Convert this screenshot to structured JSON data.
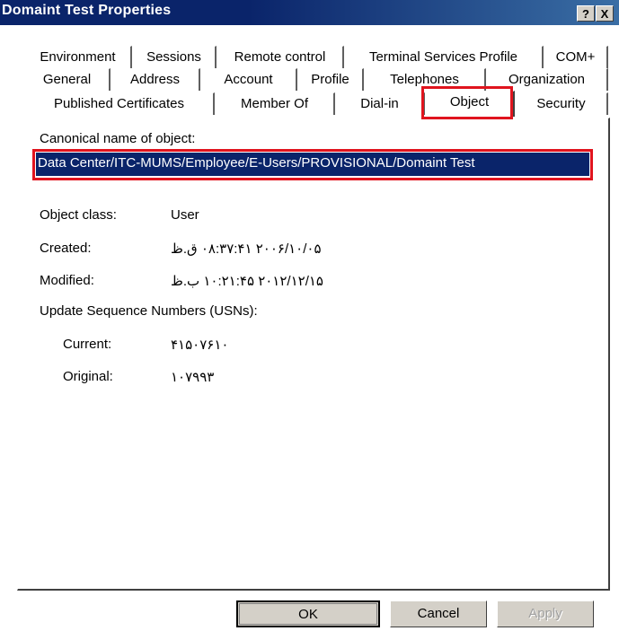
{
  "window": {
    "title": "Domaint Test Properties",
    "help_label": "?",
    "close_label": "X"
  },
  "tabs": {
    "row1": [
      "Environment",
      "Sessions",
      "Remote control",
      "Terminal Services Profile",
      "COM+"
    ],
    "row2": [
      "General",
      "Address",
      "Account",
      "Profile",
      "Telephones",
      "Organization"
    ],
    "row3": [
      "Published Certificates",
      "Member Of",
      "Dial-in",
      "Object",
      "Security"
    ],
    "active": "Object"
  },
  "object": {
    "canonical_label": "Canonical name of object:",
    "canonical_value": "Data Center/ITC-MUMS/Employee/E-Users/PROVISIONAL/Domaint Test",
    "class_label": "Object class:",
    "class_value": "User",
    "created_label": "Created:",
    "created_value": "۲۰۰۶/۱۰/۰۵ ۰۸:۳۷:۴۱ ق.ظ",
    "modified_label": "Modified:",
    "modified_value": "۲۰۱۲/۱۲/۱۵ ۱۰:۲۱:۴۵ ب.ظ",
    "usn_label": "Update Sequence Numbers (USNs):",
    "current_label": "Current:",
    "current_value": "۴۱۵۰۷۶۱۰",
    "original_label": "Original:",
    "original_value": "۱۰۷۹۹۳"
  },
  "buttons": {
    "ok": "OK",
    "cancel": "Cancel",
    "apply": "Apply"
  },
  "colors": {
    "highlight": "#e0141e",
    "selection": "#0a246a",
    "titlebar": "#0a246a"
  }
}
